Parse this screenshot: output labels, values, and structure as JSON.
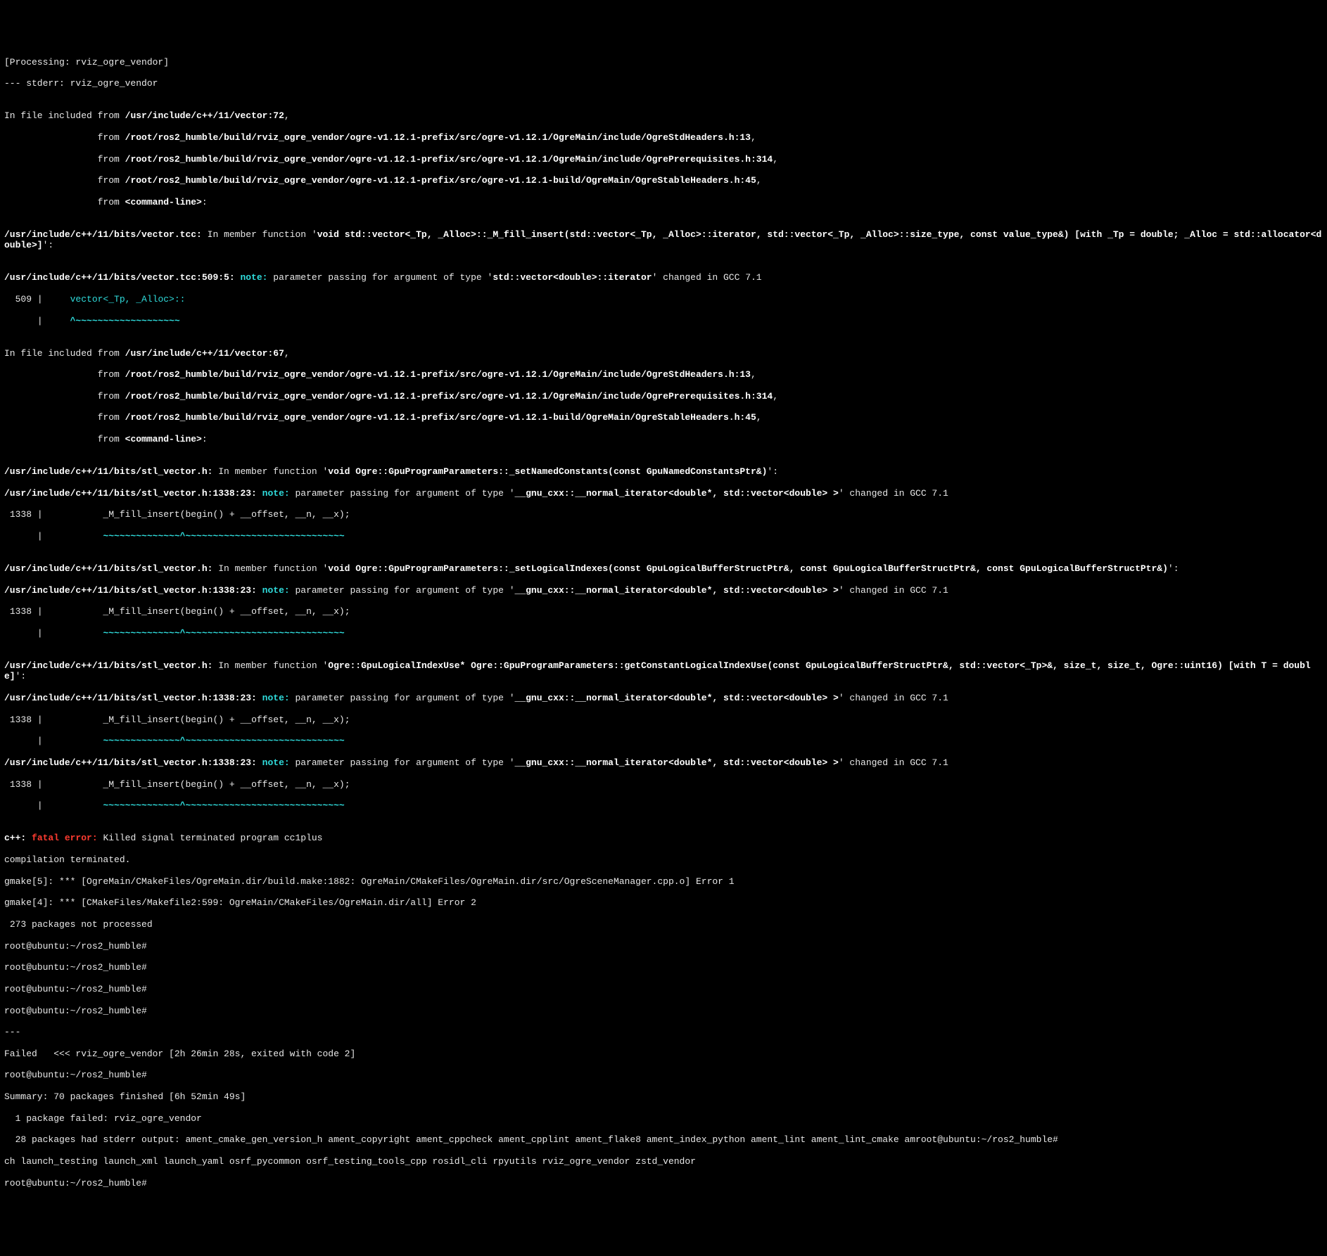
{
  "header": {
    "processing": "[Processing: rviz_ogre_vendor]",
    "stderr": "--- stderr: rviz_ogre_vendor"
  },
  "blockA": {
    "l1a": "In file included from ",
    "l1b": "/usr/include/c++/11/vector:72",
    "l1c": ",",
    "l2a": "                 from ",
    "l2b": "/root/ros2_humble/build/rviz_ogre_vendor/ogre-v1.12.1-prefix/src/ogre-v1.12.1/OgreMain/include/OgreStdHeaders.h:13",
    "l2c": ",",
    "l3a": "                 from ",
    "l3b": "/root/ros2_humble/build/rviz_ogre_vendor/ogre-v1.12.1-prefix/src/ogre-v1.12.1/OgreMain/include/OgrePrerequisites.h:314",
    "l3c": ",",
    "l4a": "                 from ",
    "l4b": "/root/ros2_humble/build/rviz_ogre_vendor/ogre-v1.12.1-prefix/src/ogre-v1.12.1-build/OgreMain/OgreStableHeaders.h:45",
    "l4c": ",",
    "l5a": "                 from ",
    "l5b": "<command-line>",
    "l5c": ":"
  },
  "msgA": {
    "loc": "/usr/include/c++/11/bits/vector.tcc:",
    "txt": " In member function '",
    "sig": "void std::vector<_Tp, _Alloc>::_M_fill_insert(std::vector<_Tp, _Alloc>::iterator, std::vector<_Tp, _Alloc>::size_type, const value_type&) [with _Tp = double; _Alloc = std::allocator<double>]",
    "end": "':"
  },
  "noteA": {
    "loc": "/usr/include/c++/11/bits/vector.tcc:509:5:",
    "kw": " note: ",
    "txt": "parameter passing for argument of type '",
    "ty": "std::vector<double>::iterator",
    "end": "' changed in GCC 7.1",
    "code_ln": "  509 |     ",
    "code": "vector<_Tp, _Alloc>::",
    "caret_ln": "      |     ",
    "caret": "^~~~~~~~~~~~~~~~~~~~"
  },
  "blockB": {
    "l1a": "In file included from ",
    "l1b": "/usr/include/c++/11/vector:67",
    "l1c": ",",
    "l2a": "                 from ",
    "l2b": "/root/ros2_humble/build/rviz_ogre_vendor/ogre-v1.12.1-prefix/src/ogre-v1.12.1/OgreMain/include/OgreStdHeaders.h:13",
    "l2c": ",",
    "l3a": "                 from ",
    "l3b": "/root/ros2_humble/build/rviz_ogre_vendor/ogre-v1.12.1-prefix/src/ogre-v1.12.1/OgreMain/include/OgrePrerequisites.h:314",
    "l3c": ",",
    "l4a": "                 from ",
    "l4b": "/root/ros2_humble/build/rviz_ogre_vendor/ogre-v1.12.1-prefix/src/ogre-v1.12.1-build/OgreMain/OgreStableHeaders.h:45",
    "l4c": ",",
    "l5a": "                 from ",
    "l5b": "<command-line>",
    "l5c": ":"
  },
  "msgB": {
    "loc": "/usr/include/c++/11/bits/stl_vector.h:",
    "txt": " In member function '",
    "sig": "void Ogre::GpuProgramParameters::_setNamedConstants(const GpuNamedConstantsPtr&)",
    "end": "':"
  },
  "noteGeneric": {
    "loc": "/usr/include/c++/11/bits/stl_vector.h:1338:23:",
    "kw": " note: ",
    "txt": "parameter passing for argument of type '",
    "ty": "__gnu_cxx::__normal_iterator<double*, std::vector<double> >",
    "end": "' changed in GCC 7.1",
    "code_ln": " 1338 |           _M_fill_insert(begin() + __offset, __n, __x);",
    "caret_ln": "      |           ",
    "caret": "~~~~~~~~~~~~~~^~~~~~~~~~~~~~~~~~~~~~~~~~~~~~"
  },
  "msgC": {
    "loc": "/usr/include/c++/11/bits/stl_vector.h:",
    "txt": " In member function '",
    "sig": "void Ogre::GpuProgramParameters::_setLogicalIndexes(const GpuLogicalBufferStructPtr&, const GpuLogicalBufferStructPtr&, const GpuLogicalBufferStructPtr&)",
    "end": "':"
  },
  "msgD": {
    "loc": "/usr/include/c++/11/bits/stl_vector.h:",
    "txt": " In member function '",
    "sig": "Ogre::GpuLogicalIndexUse* Ogre::GpuProgramParameters::getConstantLogicalIndexUse(const GpuLogicalBufferStructPtr&, std::vector<_Tp>&, size_t, size_t, Ogre::uint16) [with T = double]",
    "end": "':"
  },
  "fatal": {
    "prog": "c++: ",
    "kw": "fatal error: ",
    "txt": "Killed signal terminated program cc1plus",
    "term": "compilation terminated."
  },
  "gmake": {
    "l1": "gmake[5]: *** [OgreMain/CMakeFiles/OgreMain.dir/build.make:1882: OgreMain/CMakeFiles/OgreMain.dir/src/OgreSceneManager.cpp.o] Error 1",
    "l2": "gmake[4]: *** [CMakeFiles/Makefile2:599: OgreMain/CMakeFiles/OgreMain.dir/all] Error 2",
    "l3": " 273 packages not processed"
  },
  "prompts": {
    "p1": "root@ubuntu:~/ros2_humble#",
    "p2": "root@ubuntu:~/ros2_humble#",
    "p3": "root@ubuntu:~/ros2_humble#",
    "p4": "root@ubuntu:~/ros2_humble#",
    "dash": "---",
    "failed": "Failed   <<< rviz_ogre_vendor [2h 26min 28s, exited with code 2]",
    "p5": "root@ubuntu:~/ros2_humble#",
    "summary": "Summary: 70 packages finished [6h 52min 49s]",
    "fail1": "  1 package failed: rviz_ogre_vendor",
    "stderr28": "  28 packages had stderr output: ament_cmake_gen_version_h ament_copyright ament_cppcheck ament_cpplint ament_flake8 ament_index_python ament_lint ament_lint_cmake amroot@ubuntu:~/ros2_humble#",
    "wrap": "ch launch_testing launch_xml launch_yaml osrf_pycommon osrf_testing_tools_cpp rosidl_cli rpyutils rviz_ogre_vendor zstd_vendor",
    "p6": "root@ubuntu:~/ros2_humble#"
  }
}
